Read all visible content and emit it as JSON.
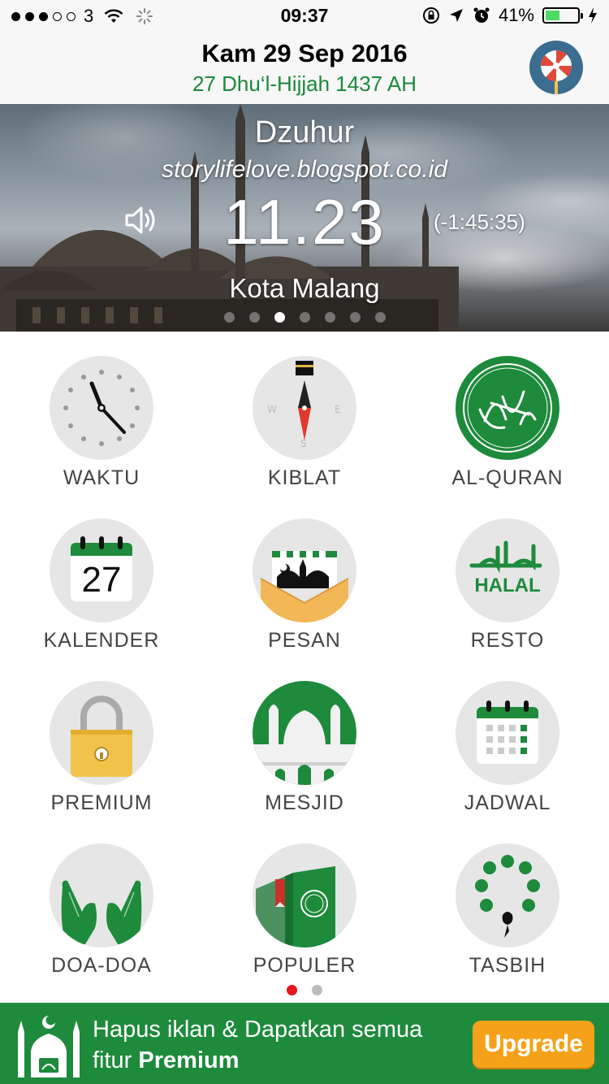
{
  "status_bar": {
    "carrier": "3",
    "time": "09:37",
    "battery": "41%",
    "battery_level": 0.41,
    "signal_dots": [
      true,
      true,
      true,
      false,
      false
    ]
  },
  "header": {
    "gregorian_date": "Kam 29 Sep 2016",
    "hijri_date": "27 Dhu‘l-Hijjah 1437 AH"
  },
  "hero": {
    "prayer_name": "Dzuhur",
    "watermark": "storylifelove.blogspot.co.id",
    "prayer_time": "11.23",
    "countdown": "(-1:45:35)",
    "city": "Kota Malang",
    "page_count": 7,
    "active_page": 2
  },
  "menu": {
    "items": [
      {
        "label": "WAKTU",
        "icon": "clock-icon"
      },
      {
        "label": "KIBLAT",
        "icon": "compass-icon"
      },
      {
        "label": "AL-QURAN",
        "icon": "quran-icon"
      },
      {
        "label": "KALENDER",
        "icon": "calendar-icon",
        "icon_text": "27"
      },
      {
        "label": "PESAN",
        "icon": "message-envelope-icon"
      },
      {
        "label": "RESTO",
        "icon": "halal-icon",
        "icon_text": "HALAL"
      },
      {
        "label": "PREMIUM",
        "icon": "padlock-icon"
      },
      {
        "label": "MESJID",
        "icon": "mosque-icon"
      },
      {
        "label": "JADWAL",
        "icon": "schedule-icon"
      },
      {
        "label": "DOA-DOA",
        "icon": "praying-hands-icon"
      },
      {
        "label": "POPULER",
        "icon": "book-icon"
      },
      {
        "label": "TASBIH",
        "icon": "prayer-beads-icon"
      }
    ],
    "page_count": 2,
    "active_page": 0
  },
  "banner": {
    "message_line1": "Hapus iklan & Dapatkan semua",
    "message_prefix": "fitur ",
    "message_bold": "Premium",
    "button_label": "Upgrade"
  },
  "colors": {
    "brand_green": "#1e8a3c",
    "upgrade_orange": "#f5a21b",
    "active_dot_red": "#e8141c"
  }
}
